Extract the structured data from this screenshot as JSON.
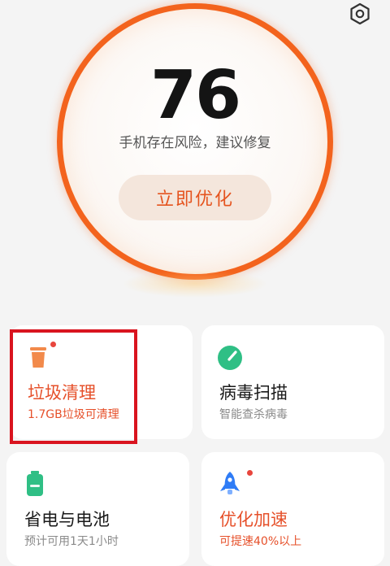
{
  "header": {
    "settings_icon": "settings-hexagon-icon"
  },
  "score": {
    "value": "76",
    "status": "手机存在风险，建议修复",
    "button_label": "立即优化",
    "ring_color": "#f3631d"
  },
  "cards": [
    {
      "title": "垃圾清理",
      "subtitle": "1.7GB垃圾可清理",
      "icon": "trash-bin-icon",
      "title_color": "#e6502a",
      "subtitle_color": "#e6502a",
      "has_dot": true
    },
    {
      "title": "病毒扫描",
      "subtitle": "智能查杀病毒",
      "icon": "virus-scan-icon",
      "title_color": "#1a1a1a",
      "subtitle_color": "#8a8a8a",
      "has_dot": false
    },
    {
      "title": "省电与电池",
      "subtitle": "预计可用1天1小时",
      "icon": "battery-icon",
      "title_color": "#1a1a1a",
      "subtitle_color": "#8a8a8a",
      "has_dot": false
    },
    {
      "title": "优化加速",
      "subtitle": "可提速40%以上",
      "icon": "rocket-icon",
      "title_color": "#e6502a",
      "subtitle_color": "#e6502a",
      "has_dot": true
    }
  ],
  "colors": {
    "accent": "#f3631d",
    "alert_dot": "#e8453c",
    "green": "#2fbf85",
    "blue": "#2f7cf6",
    "highlight_box": "#d9141f"
  }
}
